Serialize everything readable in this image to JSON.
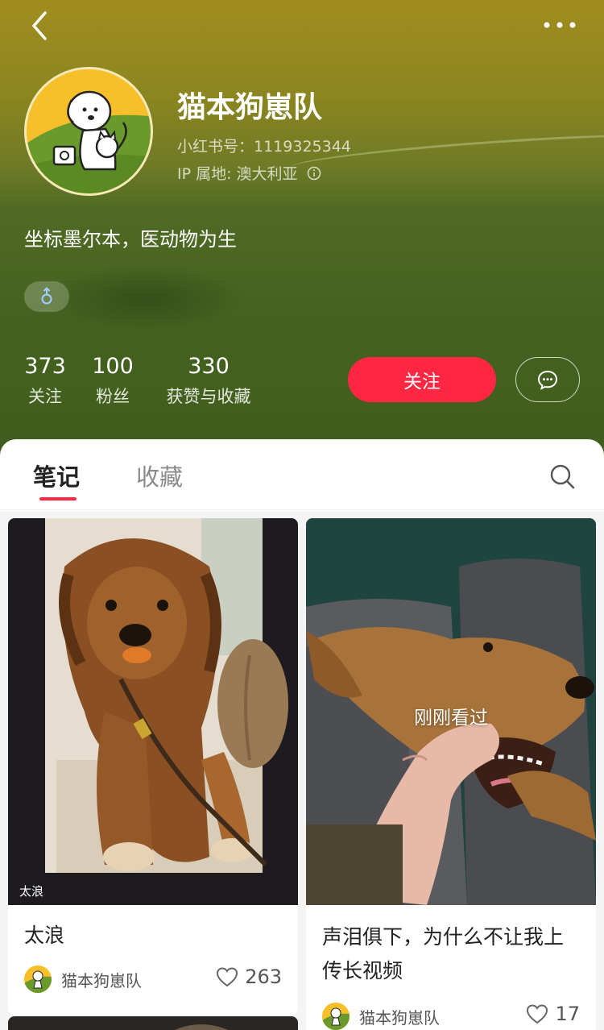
{
  "header": {
    "nickname": "猫本狗崽队",
    "red_id": "小红书号：1119325344",
    "ip_location": "IP 属地: 澳大利亚",
    "bio": "坐标墨尔本，医动物为生",
    "gender_symbol": "♂",
    "gender_icon": "male-icon"
  },
  "stats": [
    {
      "value": "373",
      "label": "关注"
    },
    {
      "value": "100",
      "label": "粉丝"
    },
    {
      "value": "330",
      "label": "获赞与收藏"
    }
  ],
  "actions": {
    "follow_label": "关注",
    "chat_icon": "chat-bubble-icon"
  },
  "tabs": {
    "notes": "笔记",
    "collections": "收藏",
    "search_icon": "search-icon"
  },
  "feed": [
    {
      "title": "太浪",
      "cover_caption": "太浪",
      "author": "猫本狗崽队",
      "likes": "263"
    },
    {
      "title": "声泪俱下，为什么不让我上传长视频",
      "overlay": "刚刚看过",
      "author": "猫本狗崽队",
      "likes": "17"
    }
  ],
  "colors": {
    "accent": "#ff2741",
    "header_green": "#44621f",
    "header_gold": "#a08d1e"
  }
}
